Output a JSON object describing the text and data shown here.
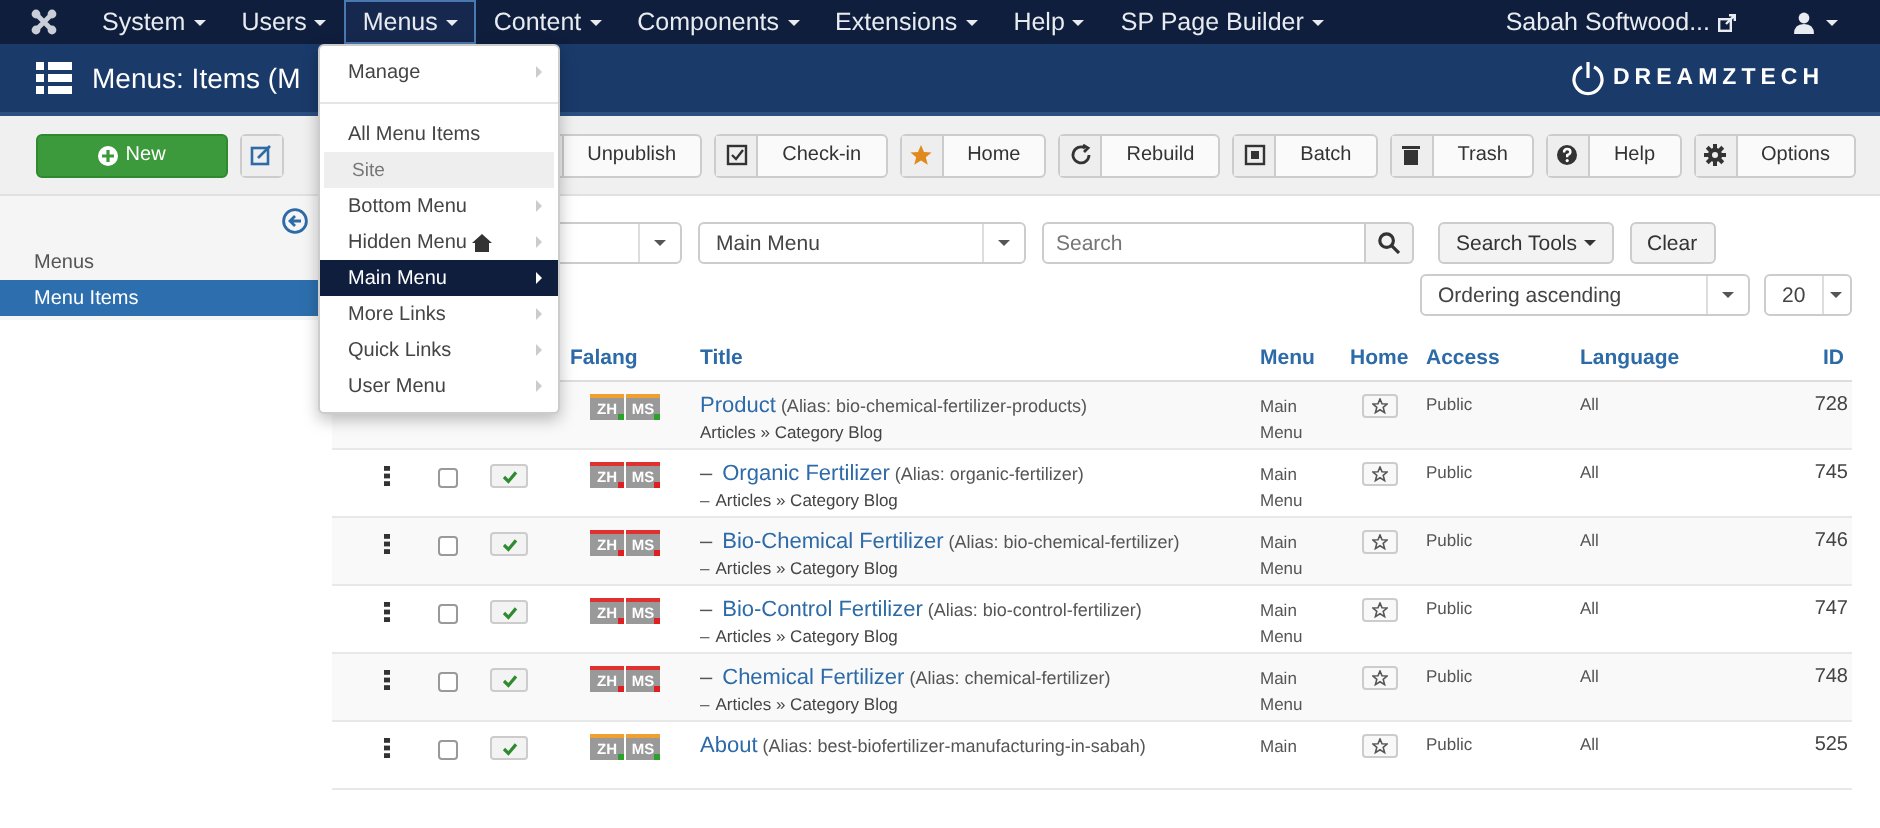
{
  "nav": {
    "items": [
      {
        "label": "System",
        "active": false
      },
      {
        "label": "Users",
        "active": false
      },
      {
        "label": "Menus",
        "active": true
      },
      {
        "label": "Content",
        "active": false
      },
      {
        "label": "Components",
        "active": false
      },
      {
        "label": "Extensions",
        "active": false
      },
      {
        "label": "Help",
        "active": false
      },
      {
        "label": "SP Page Builder",
        "active": false
      }
    ],
    "site": "Sabah Softwood..."
  },
  "header": {
    "title": "Menus: Items (M",
    "logo": "DREAMZTECH"
  },
  "toolbar": [
    {
      "kind": "new",
      "label": "New"
    },
    {
      "kind": "edit"
    },
    {
      "kind": "unpublish",
      "label": "Unpublish"
    },
    {
      "kind": "checkin",
      "label": "Check-in"
    },
    {
      "kind": "home",
      "label": "Home"
    },
    {
      "kind": "rebuild",
      "label": "Rebuild"
    },
    {
      "kind": "batch",
      "label": "Batch"
    },
    {
      "kind": "trash",
      "label": "Trash"
    },
    {
      "kind": "help",
      "label": "Help"
    },
    {
      "kind": "options",
      "label": "Options"
    }
  ],
  "sidebar": {
    "items": [
      {
        "label": "Menus",
        "selected": false
      },
      {
        "label": "Menu Items",
        "selected": true
      }
    ]
  },
  "filters": {
    "menu_select": "Main Menu",
    "search": {
      "placeholder": "Search"
    },
    "search_tools": "Search Tools",
    "clear": "Clear",
    "ordering": "Ordering ascending",
    "limit": "20"
  },
  "table": {
    "columns": [
      "Falang",
      "Title",
      "Menu",
      "Home",
      "Access",
      "Language",
      "ID"
    ],
    "rows": [
      {
        "falang": [
          {
            "label": "ZH",
            "kind": "ok"
          },
          {
            "label": "MS",
            "kind": "ok"
          }
        ],
        "title": "Product",
        "alias": "(Alias: bio-chemical-fertilizer-products)",
        "type": "Articles » Category Blog",
        "menu": "Main Menu",
        "home": false,
        "access": "Public",
        "language": "All",
        "id": "728",
        "children": [
          {
            "checked": false,
            "published": true,
            "falang": [
              {
                "label": "ZH",
                "kind": "missing"
              },
              {
                "label": "MS",
                "kind": "missing"
              }
            ],
            "title_dash": "–",
            "title": "Organic Fertilizer",
            "alias": "(Alias: organic-fertilizer)",
            "type_dash": "–",
            "type": "Articles » Category Blog",
            "menu": "Main Menu",
            "home": false,
            "access": "Public",
            "language": "All",
            "id": "745"
          },
          {
            "checked": false,
            "published": true,
            "falang": [
              {
                "label": "ZH",
                "kind": "missing"
              },
              {
                "label": "MS",
                "kind": "missing"
              }
            ],
            "title_dash": "–",
            "title": "Bio-Chemical Fertilizer",
            "alias": "(Alias: bio-chemical-fertilizer)",
            "type_dash": "–",
            "type": "Articles » Category Blog",
            "menu": "Main Menu",
            "home": false,
            "access": "Public",
            "language": "All",
            "id": "746"
          },
          {
            "checked": false,
            "published": true,
            "falang": [
              {
                "label": "ZH",
                "kind": "missing"
              },
              {
                "label": "MS",
                "kind": "missing"
              }
            ],
            "title_dash": "–",
            "title": "Bio-Control Fertilizer",
            "alias": "(Alias: bio-control-fertilizer)",
            "type_dash": "–",
            "type": "Articles » Category Blog",
            "menu": "Main Menu",
            "home": false,
            "access": "Public",
            "language": "All",
            "id": "747"
          },
          {
            "checked": false,
            "published": true,
            "falang": [
              {
                "label": "ZH",
                "kind": "missing"
              },
              {
                "label": "MS",
                "kind": "missing"
              }
            ],
            "title_dash": "–",
            "title": "Chemical Fertilizer",
            "alias": "(Alias: chemical-fertilizer)",
            "type_dash": "–",
            "type": "Articles » Category Blog",
            "menu": "Main Menu",
            "home": false,
            "access": "Public",
            "language": "All",
            "id": "748"
          }
        ]
      },
      {
        "checked": false,
        "published": true,
        "falang": [
          {
            "label": "ZH",
            "kind": "ok"
          },
          {
            "label": "MS",
            "kind": "ok"
          }
        ],
        "title": "About",
        "alias": "(Alias: best-biofertilizer-manufacturing-in-sabah)",
        "menu": "Main",
        "home": false,
        "access": "Public",
        "language": "All",
        "id": "525"
      }
    ]
  },
  "dropdown": {
    "items": [
      {
        "kind": "item",
        "label": "Manage",
        "submenu": true,
        "selected": false
      },
      {
        "kind": "divider"
      },
      {
        "kind": "item",
        "label": "All Menu Items",
        "submenu": false,
        "selected": false
      },
      {
        "kind": "header",
        "label": "Site"
      },
      {
        "kind": "item",
        "label": "Bottom Menu",
        "submenu": true,
        "selected": false
      },
      {
        "kind": "item",
        "label": "Hidden Menu",
        "home": true,
        "submenu": true,
        "selected": false
      },
      {
        "kind": "item",
        "label": "Main Menu",
        "submenu": true,
        "selected": true
      },
      {
        "kind": "item",
        "label": "More Links",
        "submenu": true,
        "selected": false
      },
      {
        "kind": "item",
        "label": "Quick Links",
        "submenu": true,
        "selected": false
      },
      {
        "kind": "item",
        "label": "User Menu",
        "submenu": true,
        "selected": false
      }
    ]
  }
}
